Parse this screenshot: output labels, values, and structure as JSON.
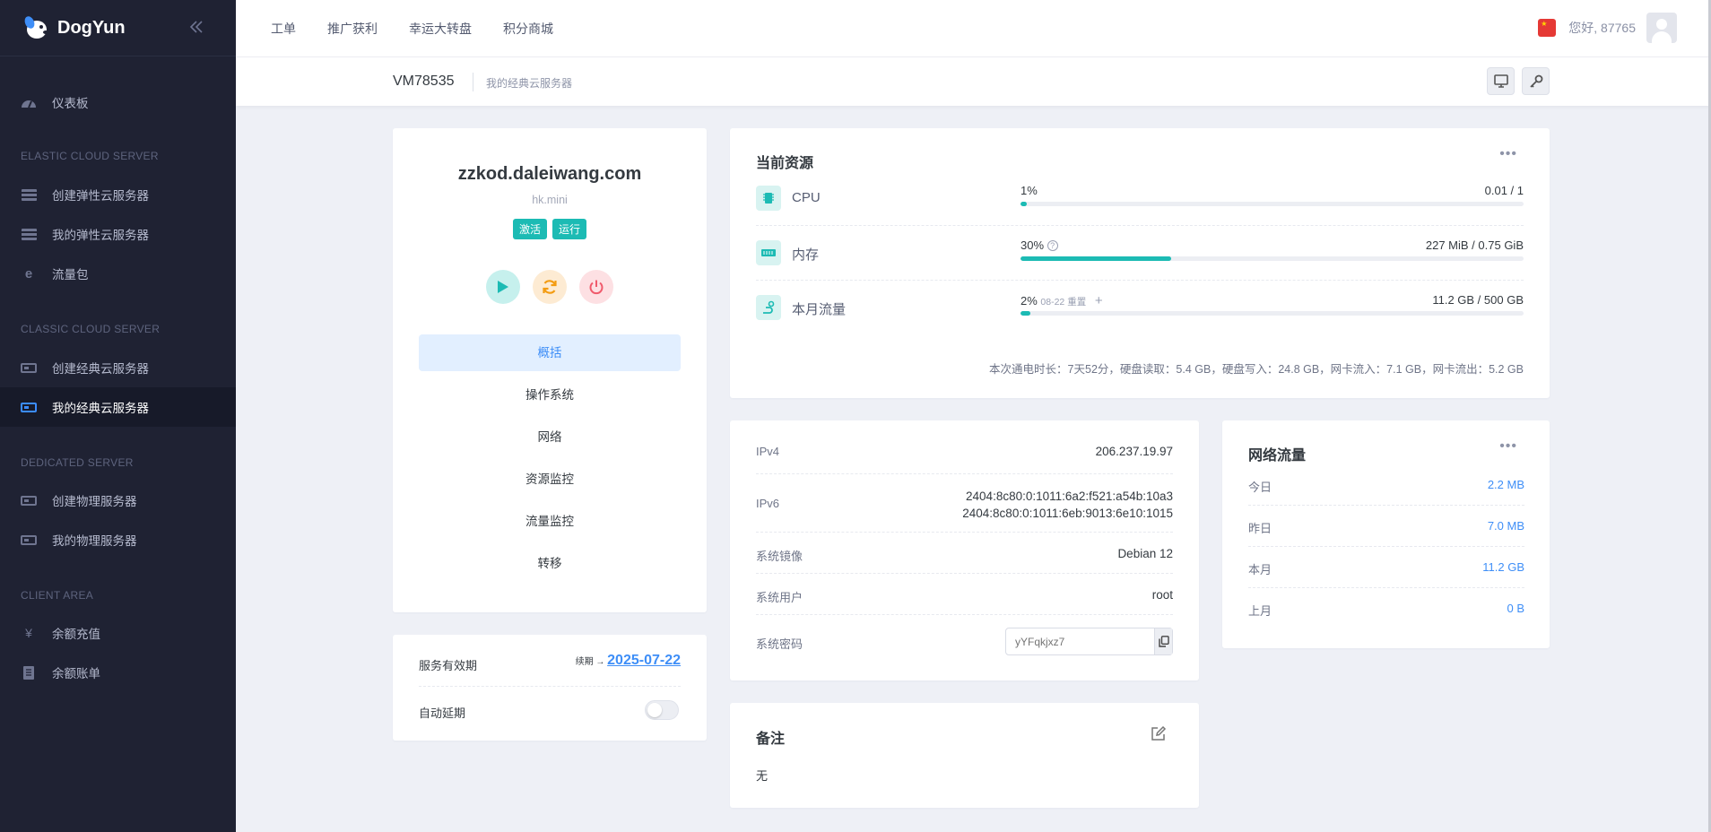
{
  "brand": {
    "name": "DogYun"
  },
  "sidebar": {
    "dashboard": "仪表板",
    "sections": [
      {
        "title": "ELASTIC CLOUD SERVER",
        "items": [
          "创建弹性云服务器",
          "我的弹性云服务器",
          "流量包"
        ]
      },
      {
        "title": "CLASSIC CLOUD SERVER",
        "items": [
          "创建经典云服务器",
          "我的经典云服务器"
        ]
      },
      {
        "title": "DEDICATED SERVER",
        "items": [
          "创建物理服务器",
          "我的物理服务器"
        ]
      },
      {
        "title": "CLIENT AREA",
        "items": [
          "余额充值",
          "余额账单"
        ]
      }
    ],
    "active_item": "我的经典云服务器"
  },
  "topnav": {
    "items": [
      "工单",
      "推广获利",
      "幸运大转盘",
      "积分商城"
    ],
    "greeting": "您好, 87765"
  },
  "page": {
    "vm_id": "VM78535",
    "subtitle": "我的经典云服务器"
  },
  "server": {
    "hostname": "zzkod.daleiwang.com",
    "plan": "hk.mini",
    "badges": [
      "激活",
      "运行"
    ],
    "tabs": [
      "概括",
      "操作系统",
      "网络",
      "资源监控",
      "流量监控",
      "转移"
    ],
    "active_tab": "概括"
  },
  "resources": {
    "title": "当前资源",
    "cpu": {
      "label": "CPU",
      "percent_text": "1%",
      "value": "0.01 / 1",
      "fill": 0.01
    },
    "memory": {
      "label": "内存",
      "percent_text": "30%",
      "value": "227 MiB / 0.75 GiB",
      "fill": 0.3
    },
    "traffic": {
      "label": "本月流量",
      "percent_text": "2%",
      "reset_date": "08-22 重置",
      "value": "11.2 GB / 500 GB",
      "fill": 0.02
    },
    "uptime": "本次通电时长：7天52分，硬盘读取：5.4 GB，硬盘写入：24.8 GB，网卡流入：7.1 GB，网卡流出：5.2 GB"
  },
  "info": {
    "ipv4_label": "IPv4",
    "ipv4": "206.237.19.97",
    "ipv6_label": "IPv6",
    "ipv6_1": "2404:8c80:0:1011:6a2:f521:a54b:10a3",
    "ipv6_2": "2404:8c80:0:1011:6eb:9013:6e10:1015",
    "image_label": "系统镜像",
    "image": "Debian 12",
    "user_label": "系统用户",
    "user": "root",
    "password_label": "系统密码",
    "password_placeholder": "yYFqkjxz7"
  },
  "network": {
    "title": "网络流量",
    "rows": [
      {
        "label": "今日",
        "value": "2.2 MB"
      },
      {
        "label": "昨日",
        "value": "7.0 MB"
      },
      {
        "label": "本月",
        "value": "11.2 GB"
      },
      {
        "label": "上月",
        "value": "0 B"
      }
    ]
  },
  "service": {
    "expiry_label": "服务有效期",
    "renew_label": "续期 →",
    "expiry_date": "2025-07-22",
    "auto_renew_label": "自动延期",
    "auto_renew": false
  },
  "notes": {
    "title": "备注",
    "content": "无"
  }
}
